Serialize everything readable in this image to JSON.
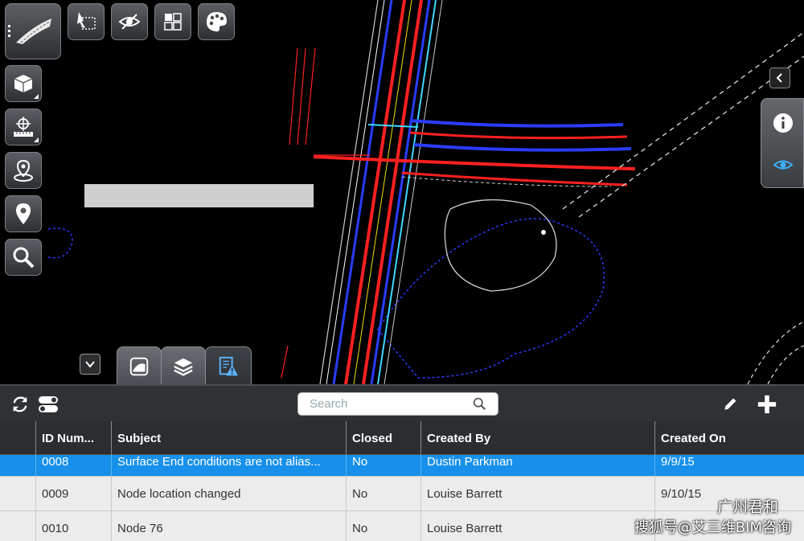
{
  "toolbar": {
    "icons": [
      "road-profile-icon",
      "select-area-icon",
      "visibility-icon",
      "layout-grid-icon",
      "palette-icon"
    ],
    "left_icons": [
      "cube-view-icon",
      "measure-icon",
      "location-pin-ring-icon",
      "map-pin-icon",
      "zoom-icon"
    ]
  },
  "bottom_tabs": [
    "model-tab",
    "layers-tab",
    "issues-tab"
  ],
  "search": {
    "placeholder": "Search"
  },
  "table": {
    "columns": [
      "ID Num...",
      "Subject",
      "Closed",
      "Created By",
      "Created On"
    ],
    "rows": [
      {
        "id": "0008",
        "subject": "Surface End conditions are not alias...",
        "closed": "No",
        "created_by": "Dustin Parkman",
        "created_on": "9/9/15",
        "selected": true
      },
      {
        "id": "0009",
        "subject": "Node location changed",
        "closed": "No",
        "created_by": "Louise Barrett",
        "created_on": "9/10/15",
        "selected": false
      },
      {
        "id": "0010",
        "subject": "Node 76",
        "closed": "No",
        "created_by": "Louise Barrett",
        "created_on": "",
        "selected": false
      }
    ]
  },
  "watermark": {
    "line1": "广州君和",
    "line2": "搜狐号@艾三维BIM咨询"
  },
  "colors": {
    "selected_row": "#1690ea",
    "header_bg": "#2b2e31",
    "cad_red": "#ff2020",
    "cad_blue": "#2a3cff",
    "cad_cyan": "#40d8ff"
  }
}
